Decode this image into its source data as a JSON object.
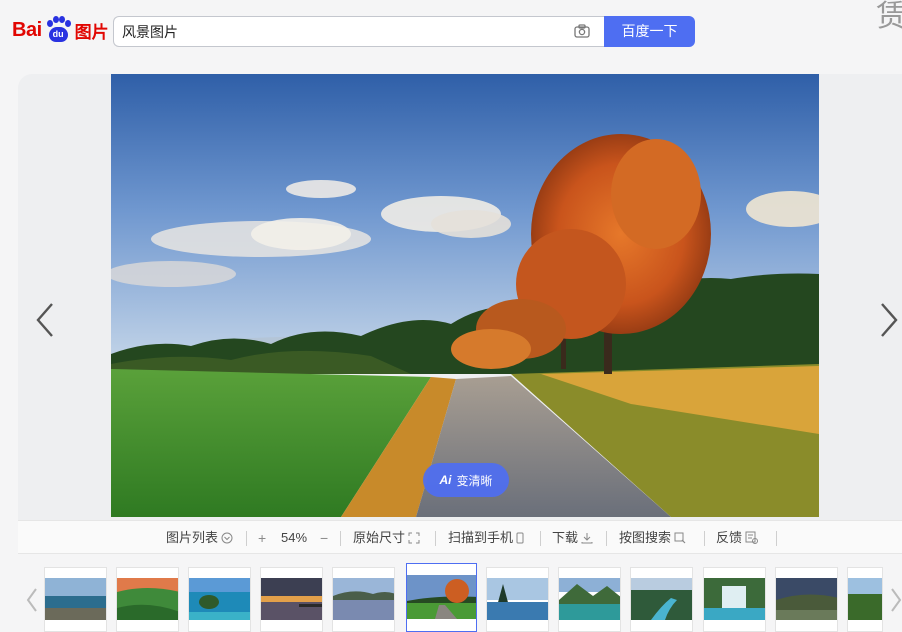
{
  "logo": {
    "bai": "Bai",
    "du": "du",
    "tupian": "图片"
  },
  "search": {
    "value": "风景图片",
    "button_label": "百度一下"
  },
  "corner_glyph": "赁",
  "ai_button": {
    "mark": "Ai",
    "label": "变清晰"
  },
  "toolbar": {
    "image_list": "图片列表",
    "zoom_in": "+",
    "zoom_level": "54%",
    "zoom_out": "−",
    "original_size": "原始尺寸",
    "scan_to_phone": "扫描到手机",
    "download": "下载",
    "search_by_image": "按图搜索",
    "feedback": "反馈"
  },
  "thumbnails": [
    {
      "name": "coast-cliffs"
    },
    {
      "name": "green-valley-sunset"
    },
    {
      "name": "tropical-bay"
    },
    {
      "name": "pier-sunset"
    },
    {
      "name": "lake-reflection"
    },
    {
      "name": "autumn-road",
      "active": true
    },
    {
      "name": "pine-lake"
    },
    {
      "name": "mountain-lake"
    },
    {
      "name": "river-valley"
    },
    {
      "name": "waterfall-cascade"
    },
    {
      "name": "dusk-hills"
    },
    {
      "name": "forest-edge"
    }
  ],
  "colors": {
    "accent": "#4e6ef2",
    "logo_red": "#e10602",
    "logo_blue": "#2932e1"
  }
}
